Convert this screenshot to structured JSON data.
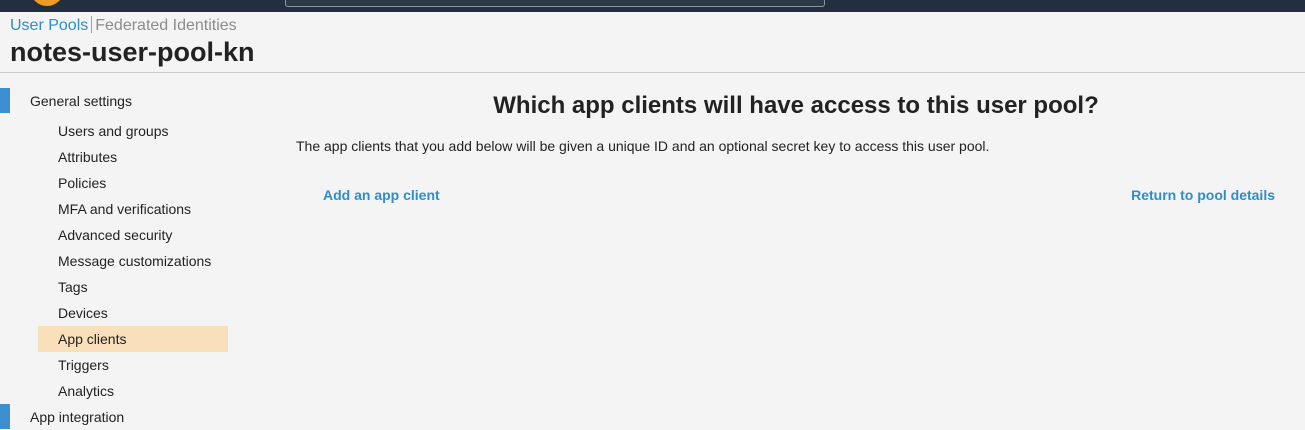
{
  "crumbs": {
    "user_pools": "User Pools",
    "federated_identities": "Federated Identities"
  },
  "pool_name": "notes-user-pool-kn",
  "sidebar": {
    "general_settings": "General settings",
    "items": [
      {
        "label": "Users and groups"
      },
      {
        "label": "Attributes"
      },
      {
        "label": "Policies"
      },
      {
        "label": "MFA and verifications"
      },
      {
        "label": "Advanced security"
      },
      {
        "label": "Message customizations"
      },
      {
        "label": "Tags"
      },
      {
        "label": "Devices"
      },
      {
        "label": "App clients",
        "selected": true
      },
      {
        "label": "Triggers"
      },
      {
        "label": "Analytics"
      }
    ],
    "app_integration": "App integration"
  },
  "main": {
    "heading": "Which app clients will have access to this user pool?",
    "description": "The app clients that you add below will be given a unique ID and an optional secret key to access this user pool.",
    "add_link": "Add an app client",
    "return_link": "Return to pool details"
  },
  "colors": {
    "accent": "#2f8dc9",
    "selected_bg": "#f9e0bb",
    "section_bar": "#3d8fd2",
    "topbar": "#232f3e",
    "logo": "#f09b25"
  }
}
